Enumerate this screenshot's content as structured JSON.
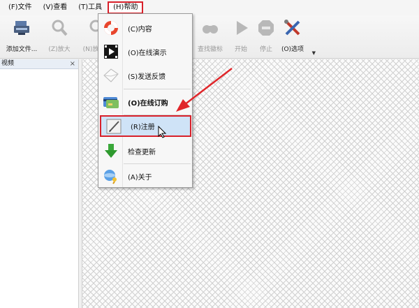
{
  "menubar": {
    "items": [
      {
        "label": "(F)文件"
      },
      {
        "label": "(V)查看"
      },
      {
        "label": "(T)工具"
      },
      {
        "label": "(H)帮助"
      }
    ]
  },
  "toolbar": {
    "add_file": "添加文件...",
    "zoom_in": "(Z)放大",
    "zoom_out": "(N)放大止",
    "find_logo": "查找徽标",
    "start": "开始",
    "stop": "停止",
    "options": "(O)选项"
  },
  "panel": {
    "title": "视频",
    "close": "×"
  },
  "help_menu": {
    "items": [
      {
        "label": "(C)内容",
        "icon": "lifebuoy-icon"
      },
      {
        "label": "(O)在线演示",
        "icon": "film-clapper-icon"
      },
      {
        "label": "(S)发送反馈",
        "icon": "envelope-icon"
      },
      {
        "label": "(O)在线订购",
        "icon": "credit-card-icon"
      },
      {
        "label": "(R)注册",
        "icon": "register-pen-icon"
      },
      {
        "label": "检查更新",
        "icon": "download-arrow-icon"
      },
      {
        "label": "(A)关于",
        "icon": "about-globe-icon"
      }
    ]
  },
  "colors": {
    "highlight_border": "#d8202a",
    "highlight_fill": "#cfe3f7",
    "annotation_arrow": "#e0262a"
  }
}
